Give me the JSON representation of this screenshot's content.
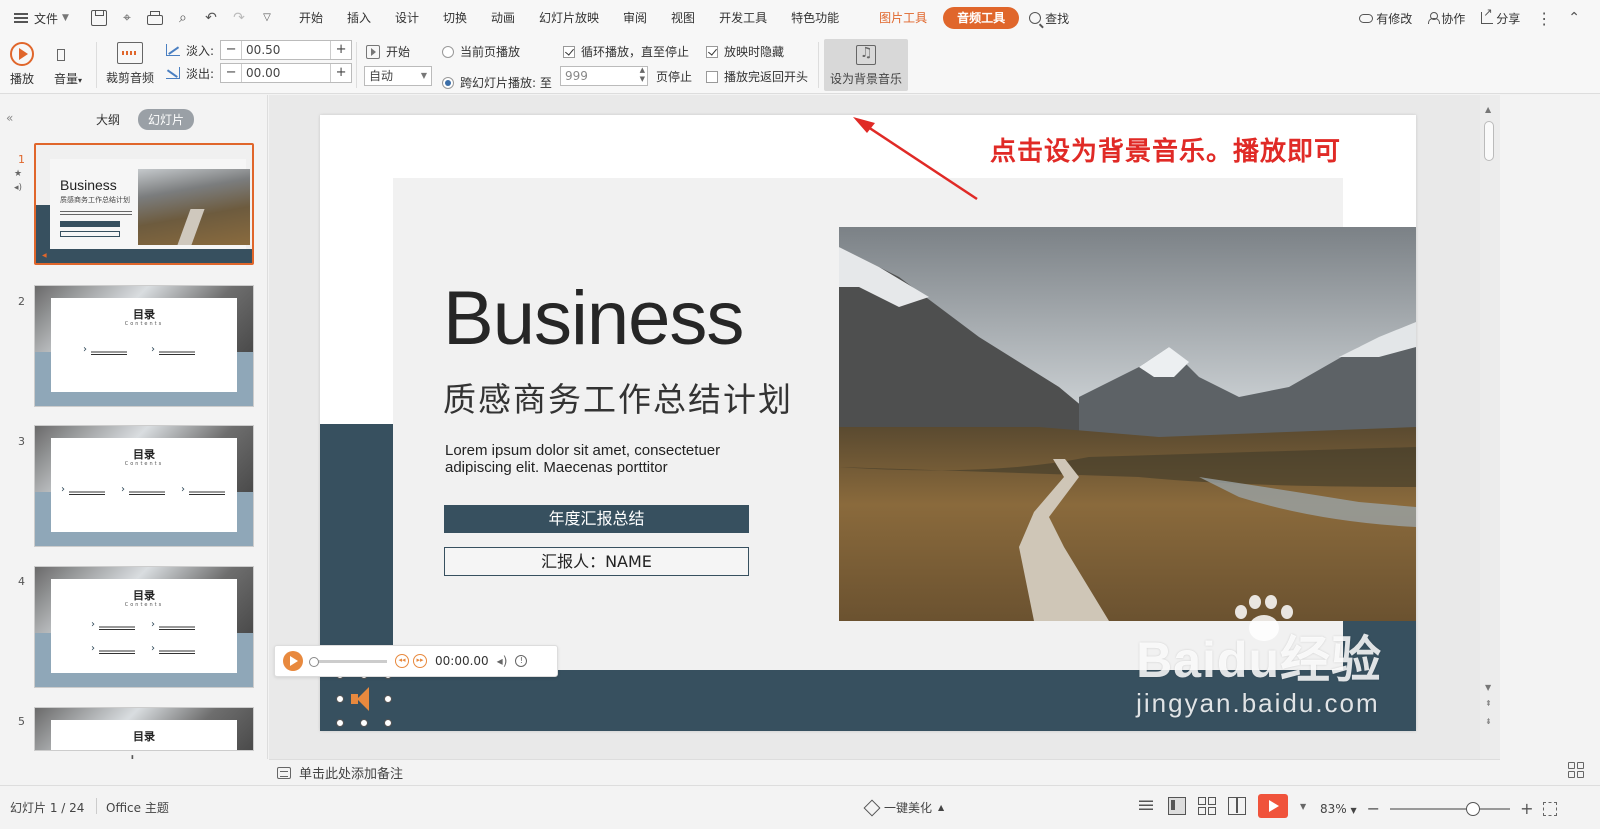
{
  "menu": {
    "file": "文件",
    "tabs": [
      "开始",
      "插入",
      "设计",
      "切换",
      "动画",
      "幻灯片放映",
      "审阅",
      "视图",
      "开发工具",
      "特色功能"
    ],
    "context_tabs": [
      "图片工具",
      "音频工具"
    ],
    "search": "查找",
    "right": {
      "modified": "有修改",
      "collab": "协作",
      "share": "分享"
    }
  },
  "ribbon": {
    "play": "播放",
    "volume": "音量",
    "trim": "裁剪音频",
    "fade_in_label": "淡入:",
    "fade_in_value": "00.50",
    "fade_out_label": "淡出:",
    "fade_out_value": "00.00",
    "start_label": "开始",
    "start_select": "自动",
    "current_page": "当前页播放",
    "cross_slide": "跨幻灯片播放: 至",
    "cross_slide_value": "999",
    "page_stop": "页停止",
    "loop": "循环播放，直至停止",
    "hide_when_playing": "放映时隐藏",
    "rewind": "播放完返回开头",
    "set_bg_music": "设为背景音乐",
    "minus": "−",
    "plus": "+"
  },
  "left_pane": {
    "outline_tab": "大纲",
    "slides_tab": "幻灯片",
    "slide_numbers": [
      "1",
      "2",
      "3",
      "4",
      "5"
    ],
    "thumb1_title": "Business",
    "thumb1_subtitle": "质感商务工作总结计划",
    "toc_title": "目录",
    "toc_sub": "Contents"
  },
  "slide": {
    "title": "Business",
    "subtitle": "质感商务工作总结计划",
    "lorem": "Lorem ipsum dolor sit amet, consectetuer adipiscing elit. Maecenas porttitor",
    "button1": "年度汇报总结",
    "button2": "汇报人：NAME"
  },
  "annotation": "点击设为背景音乐。播放即可",
  "player": {
    "time": "00:00.00"
  },
  "notes": "单击此处添加备注",
  "status": {
    "slide_count": "幻灯片 1 / 24",
    "theme": "Office 主题",
    "beautify": "一键美化",
    "zoom": "83%"
  },
  "watermark": {
    "main": "Baidu经验",
    "sub": "jingyan.baidu.com"
  },
  "colors": {
    "accent": "#e0662b",
    "slate": "#37505f",
    "annotation": "#e02a26"
  }
}
